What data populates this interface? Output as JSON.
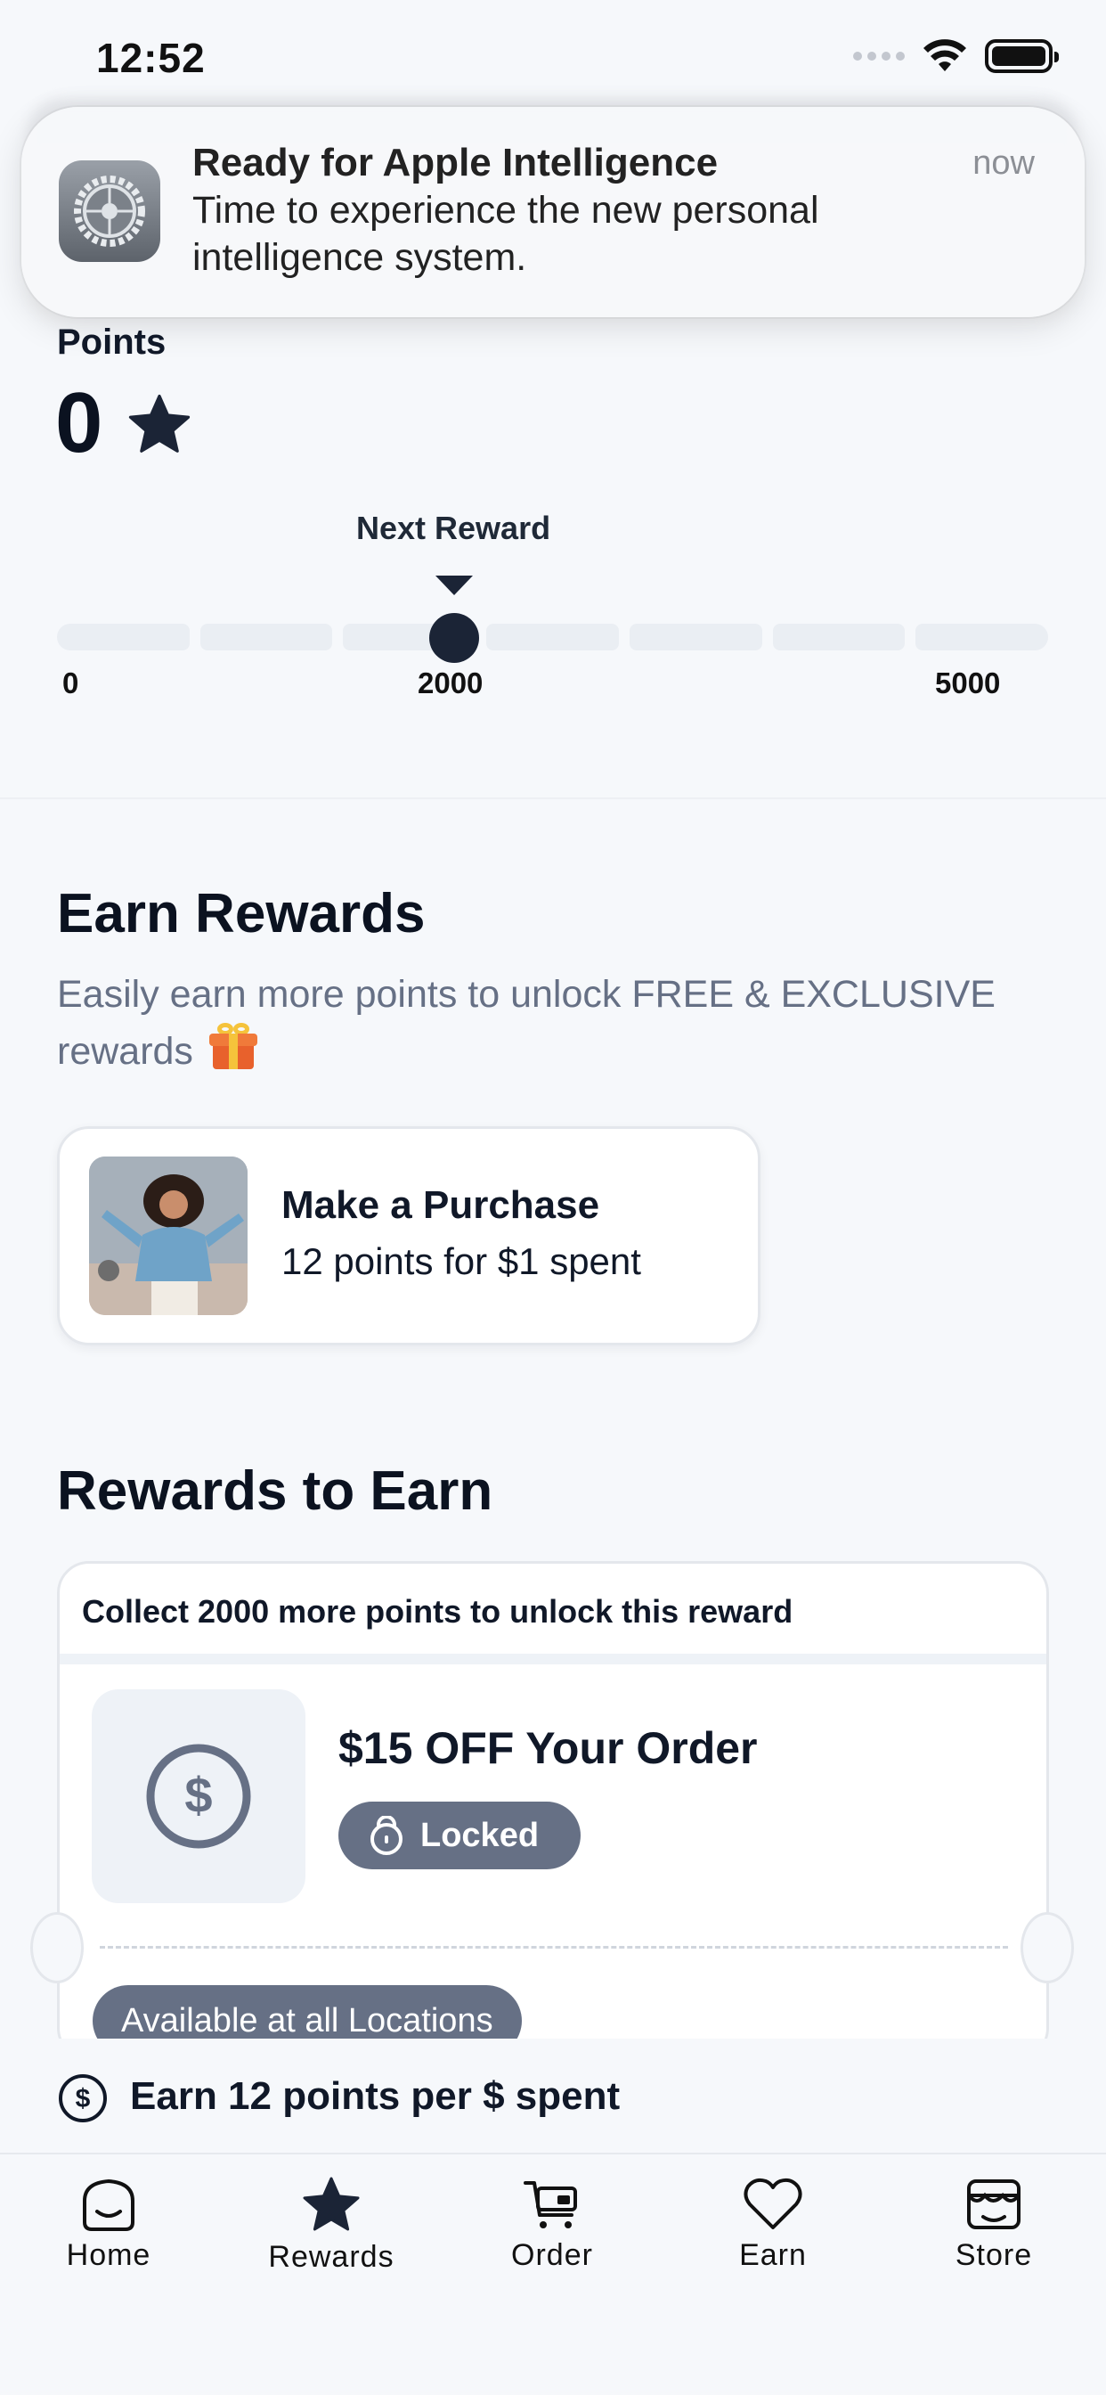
{
  "status_bar": {
    "time": "12:52"
  },
  "notification": {
    "title": "Ready for Apple Intelligence",
    "body": "Time to experience the new personal intelligence system.",
    "time": "now",
    "icon": "settings-gear-icon"
  },
  "points": {
    "label": "Points",
    "value": "0",
    "next_reward_label": "Next Reward",
    "progress": {
      "current": 0,
      "ticks": [
        "0",
        "2000",
        "5000"
      ],
      "max": 5000,
      "next_reward_at": 2000
    }
  },
  "earn_rewards": {
    "title": "Earn Rewards",
    "subtitle": "Easily earn more points to unlock FREE & EXCLUSIVE rewards",
    "card": {
      "title": "Make a Purchase",
      "subtitle": "12 points for $1 spent"
    }
  },
  "rewards_to_earn": {
    "title": "Rewards to Earn",
    "card": {
      "header": "Collect 2000 more points to unlock this reward",
      "title": "$15 OFF Your Order",
      "status": "Locked",
      "availability": "Available at all Locations"
    }
  },
  "earn_banner": {
    "text": "Earn 12 points per $ spent"
  },
  "tabs": [
    {
      "label": "Home",
      "icon": "home-icon"
    },
    {
      "label": "Rewards",
      "icon": "star-icon",
      "active": true
    },
    {
      "label": "Order",
      "icon": "cart-icon"
    },
    {
      "label": "Earn",
      "icon": "heart-icon"
    },
    {
      "label": "Store",
      "icon": "store-icon"
    }
  ],
  "colors": {
    "accent_dark": "#1b2436",
    "muted_text": "#667085",
    "pill_bg": "#667085",
    "background": "#f6f8fb"
  }
}
